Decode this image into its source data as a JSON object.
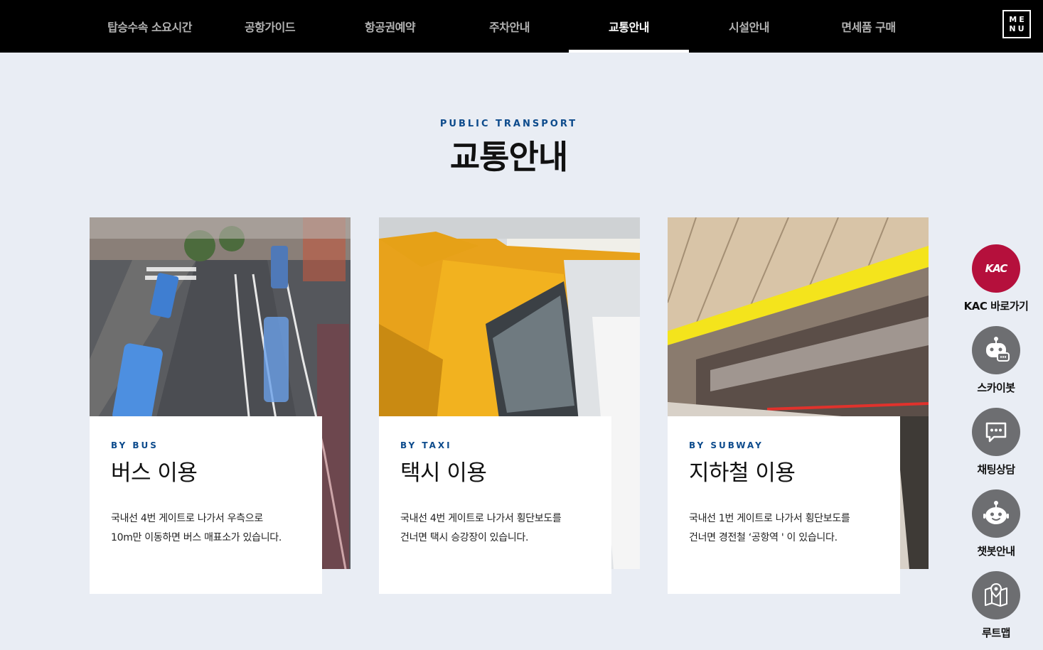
{
  "nav": {
    "items": [
      {
        "label": "탑승수속 소요시간"
      },
      {
        "label": "공항가이드"
      },
      {
        "label": "항공권예약"
      },
      {
        "label": "주차안내"
      },
      {
        "label": "교통안내"
      },
      {
        "label": "시설안내"
      },
      {
        "label": "면세품 구매"
      }
    ],
    "active_index": 4,
    "menu_line1": "ME",
    "menu_line2": "NU"
  },
  "section": {
    "eyebrow": "PUBLIC TRANSPORT",
    "title": "교통안내"
  },
  "cards": [
    {
      "eyebrow": "BY BUS",
      "title": "버스 이용",
      "desc_line1": "국내선 4번 게이트로 나가서 우측으로",
      "desc_line2": "10m만 이동하면 버스 매표소가 있습니다."
    },
    {
      "eyebrow": "BY TAXI",
      "title": "택시 이용",
      "desc_line1": "국내선 4번 게이트로 나가서 횡단보도를",
      "desc_line2": "건너면 택시 승강장이 있습니다."
    },
    {
      "eyebrow": "BY SUBWAY",
      "title": "지하철 이용",
      "desc_line1": "국내선 1번 게이트로 나가서 횡단보도를",
      "desc_line2": "건너면 경전철 ‘공항역 ' 이 있습니다."
    }
  ],
  "quick_menu": {
    "kac_logo": "KAC",
    "items": [
      {
        "label": "KAC 바로가기",
        "icon": "kac-logo-icon"
      },
      {
        "label": "스카이봇",
        "icon": "robot-chat-icon"
      },
      {
        "label": "채팅상담",
        "icon": "chat-bubble-icon"
      },
      {
        "label": "챗봇안내",
        "icon": "chatbot-face-icon"
      },
      {
        "label": "루트맵",
        "icon": "map-pin-icon"
      }
    ]
  },
  "colors": {
    "nav_bg": "#000000",
    "page_bg": "#e9edf4",
    "accent_blue": "#0d4b8c",
    "kac_red": "#b5103c",
    "quick_gray": "#6d6e71"
  }
}
